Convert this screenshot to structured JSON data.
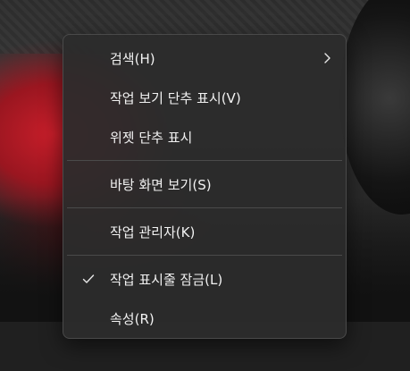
{
  "context_menu": {
    "items": [
      {
        "label": "검색(H)",
        "has_submenu": true,
        "icon": "chevron-right-icon"
      },
      {
        "label": "작업 보기 단추 표시(V)"
      },
      {
        "label": "위젯 단추 표시"
      },
      {
        "label": "바탕 화면 보기(S)"
      },
      {
        "label": "작업 관리자(K)"
      },
      {
        "label": "작업 표시줄 잠금(L)",
        "checked": true,
        "icon": "checkmark-icon"
      },
      {
        "label": "속성(R)"
      }
    ]
  },
  "colors": {
    "menu_background": "#2c2c2c",
    "menu_border": "#4a4a4a",
    "text": "#f2f2f2",
    "taskbar": "#202020"
  }
}
